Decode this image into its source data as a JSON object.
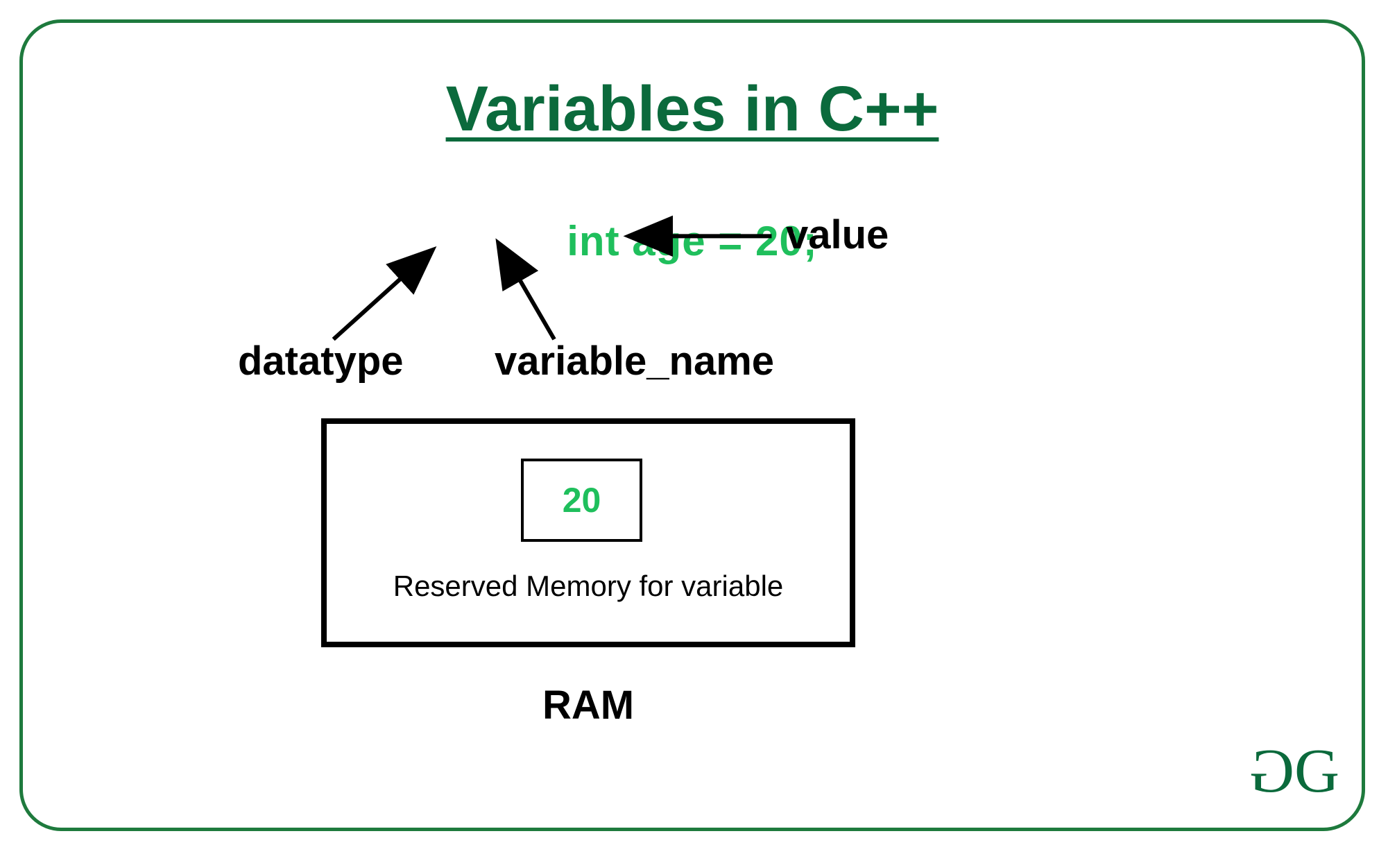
{
  "title": "Variables in C++",
  "code_line": "int age  = 20;",
  "labels": {
    "value": "value",
    "datatype": "datatype",
    "variable_name": "variable_name"
  },
  "memory": {
    "stored_value": "20",
    "caption": "Reserved Memory for variable",
    "device": "RAM"
  },
  "logo": {
    "left": "G",
    "right": "G"
  }
}
